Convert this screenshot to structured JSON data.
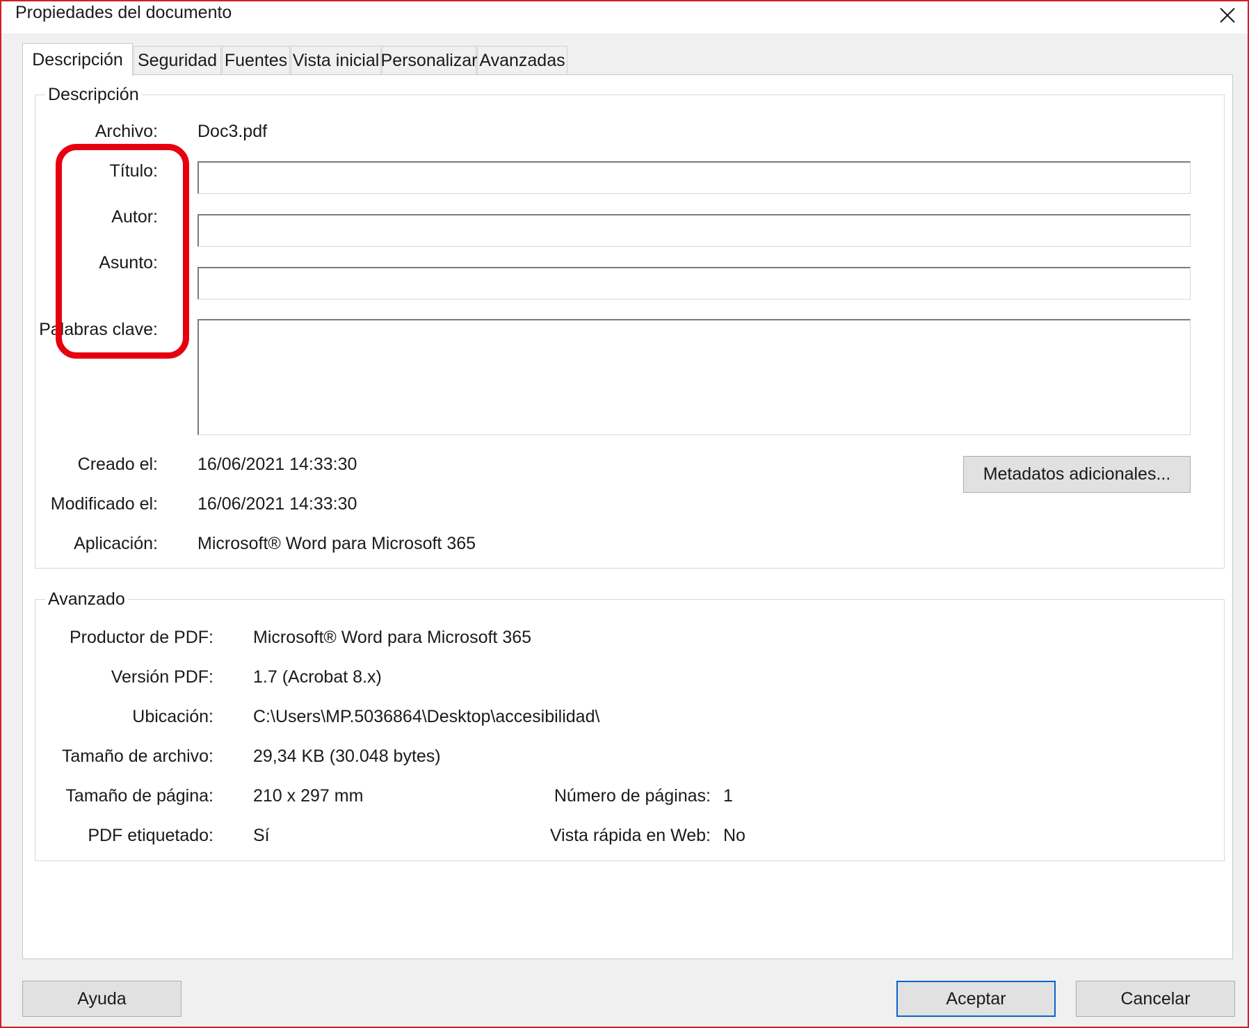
{
  "window": {
    "title": "Propiedades del documento",
    "close_glyph": "✕"
  },
  "tabs": [
    "Descripción",
    "Seguridad",
    "Fuentes",
    "Vista inicial",
    "Personalizar",
    "Avanzadas"
  ],
  "descripcion": {
    "legend": "Descripción",
    "archivo_label": "Archivo:",
    "archivo_value": "Doc3.pdf",
    "titulo_label": "Título:",
    "titulo_value": "",
    "autor_label": "Autor:",
    "autor_value": "",
    "asunto_label": "Asunto:",
    "asunto_value": "",
    "palabras_label": "Palabras clave:",
    "palabras_value": "",
    "creado_label": "Creado el:",
    "creado_value": "16/06/2021 14:33:30",
    "modificado_label": "Modificado el:",
    "modificado_value": "16/06/2021 14:33:30",
    "aplicacion_label": "Aplicación:",
    "aplicacion_value": "Microsoft® Word para Microsoft 365",
    "metadatos_button": "Metadatos adicionales..."
  },
  "avanzado": {
    "legend": "Avanzado",
    "productor_label": "Productor de PDF:",
    "productor_value": "Microsoft® Word para Microsoft 365",
    "version_label": "Versión PDF:",
    "version_value": "1.7 (Acrobat 8.x)",
    "ubicacion_label": "Ubicación:",
    "ubicacion_value": "C:\\Users\\MP.5036864\\Desktop\\accesibilidad\\",
    "tamano_archivo_label": "Tamaño de archivo:",
    "tamano_archivo_value": "29,34 KB (30.048 bytes)",
    "tamano_pagina_label": "Tamaño de página:",
    "tamano_pagina_value": "210 x 297 mm",
    "num_paginas_label": "Número de páginas:",
    "num_paginas_value": "1",
    "etiquetado_label": "PDF etiquetado:",
    "etiquetado_value": "Sí",
    "vista_rapida_label": "Vista rápida en Web:",
    "vista_rapida_value": "No"
  },
  "buttons": {
    "help": "Ayuda",
    "ok": "Aceptar",
    "cancel": "Cancelar"
  },
  "colors": {
    "highlight": "#e6000f",
    "dialog_border": "#d21f26",
    "default_button_border": "#0a64c8"
  }
}
